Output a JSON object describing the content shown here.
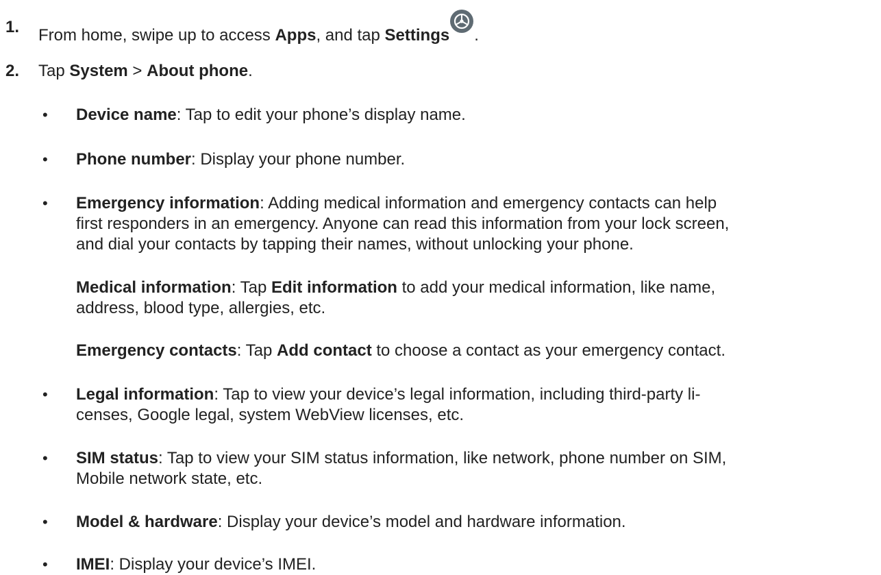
{
  "steps": [
    {
      "number": "1.",
      "parts": [
        "From home, swipe up to access ",
        "Apps",
        ", and tap ",
        "Settings",
        "."
      ],
      "icon": "settings-gear-icon"
    },
    {
      "number": "2.",
      "parts": [
        "Tap ",
        "System",
        " > ",
        "About phone",
        "."
      ]
    }
  ],
  "items": [
    {
      "term": "Device name",
      "lines": [
        ": Tap to edit your phone’s display name."
      ]
    },
    {
      "term": "Phone number",
      "lines": [
        ": Display your phone number."
      ]
    },
    {
      "term": "Emergency information",
      "lines": [
        ": Adding medical information and emergency contacts can help",
        "first responders in an emergency. Anyone can read this information from your lock screen,",
        "and dial your contacts by tapping their names, without unlocking your phone."
      ]
    },
    {
      "term": "Legal information",
      "lines": [
        ": Tap to view your device’s legal information, including third-party li-",
        "censes, Google legal, system WebView licenses, etc."
      ]
    },
    {
      "term": "SIM status",
      "lines": [
        ": Tap to view your SIM status information, like network, phone number on SIM,",
        "Mobile network state, etc."
      ]
    },
    {
      "term": "Model & hardware",
      "lines": [
        ": Display your device’s model and hardware information."
      ]
    },
    {
      "term": "IMEI",
      "lines": [
        ": Display your device’s IMEI."
      ]
    }
  ],
  "emergency_sub": {
    "medical": {
      "term": "Medical information",
      "text1": ": Tap ",
      "bold": "Edit information",
      "text2": " to add your medical information, like name,",
      "line2": "address, blood type, allergies, etc."
    },
    "contacts": {
      "term": "Emergency contacts",
      "text1": ": Tap ",
      "bold": "Add contact",
      "text2": " to choose a contact as your emergency contact."
    }
  },
  "bullet_char": "•",
  "colors": {
    "text": "#222222",
    "icon_bg": "#5f6b73"
  }
}
